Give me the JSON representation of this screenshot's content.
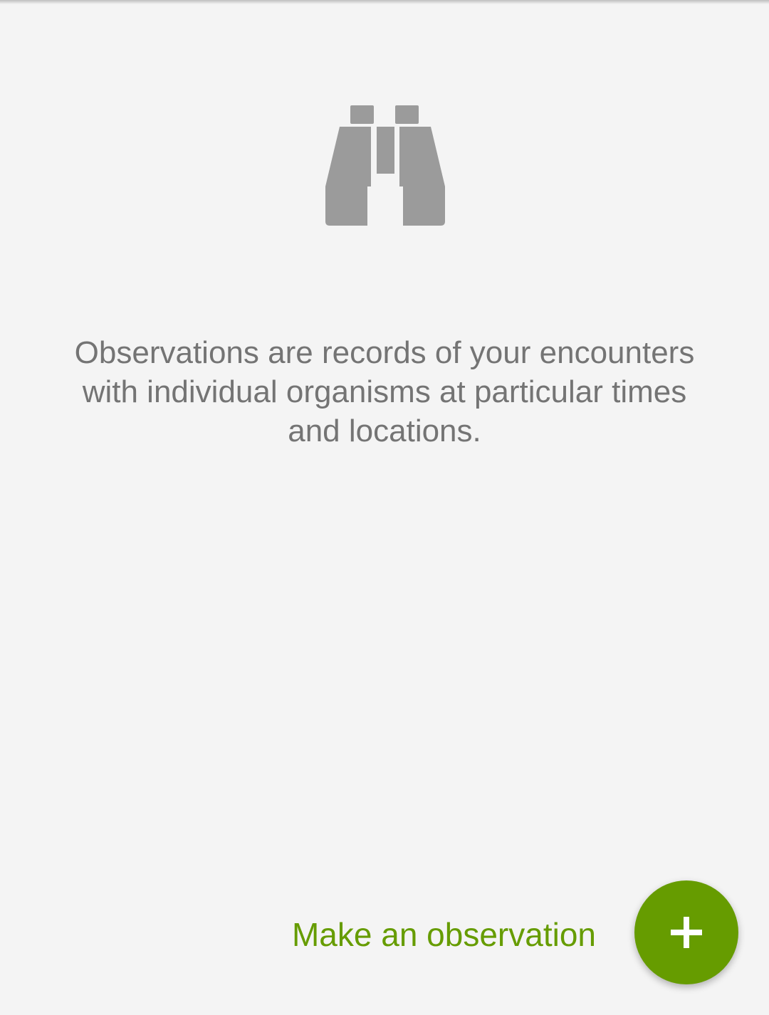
{
  "empty_state": {
    "icon": "binoculars-icon",
    "icon_color": "#9b9b9b",
    "message": "Observations are records of your encounters with individual organisms at particular times and locations."
  },
  "fab": {
    "label": "Make an observation",
    "icon": "plus-icon",
    "color": "#669c00"
  }
}
